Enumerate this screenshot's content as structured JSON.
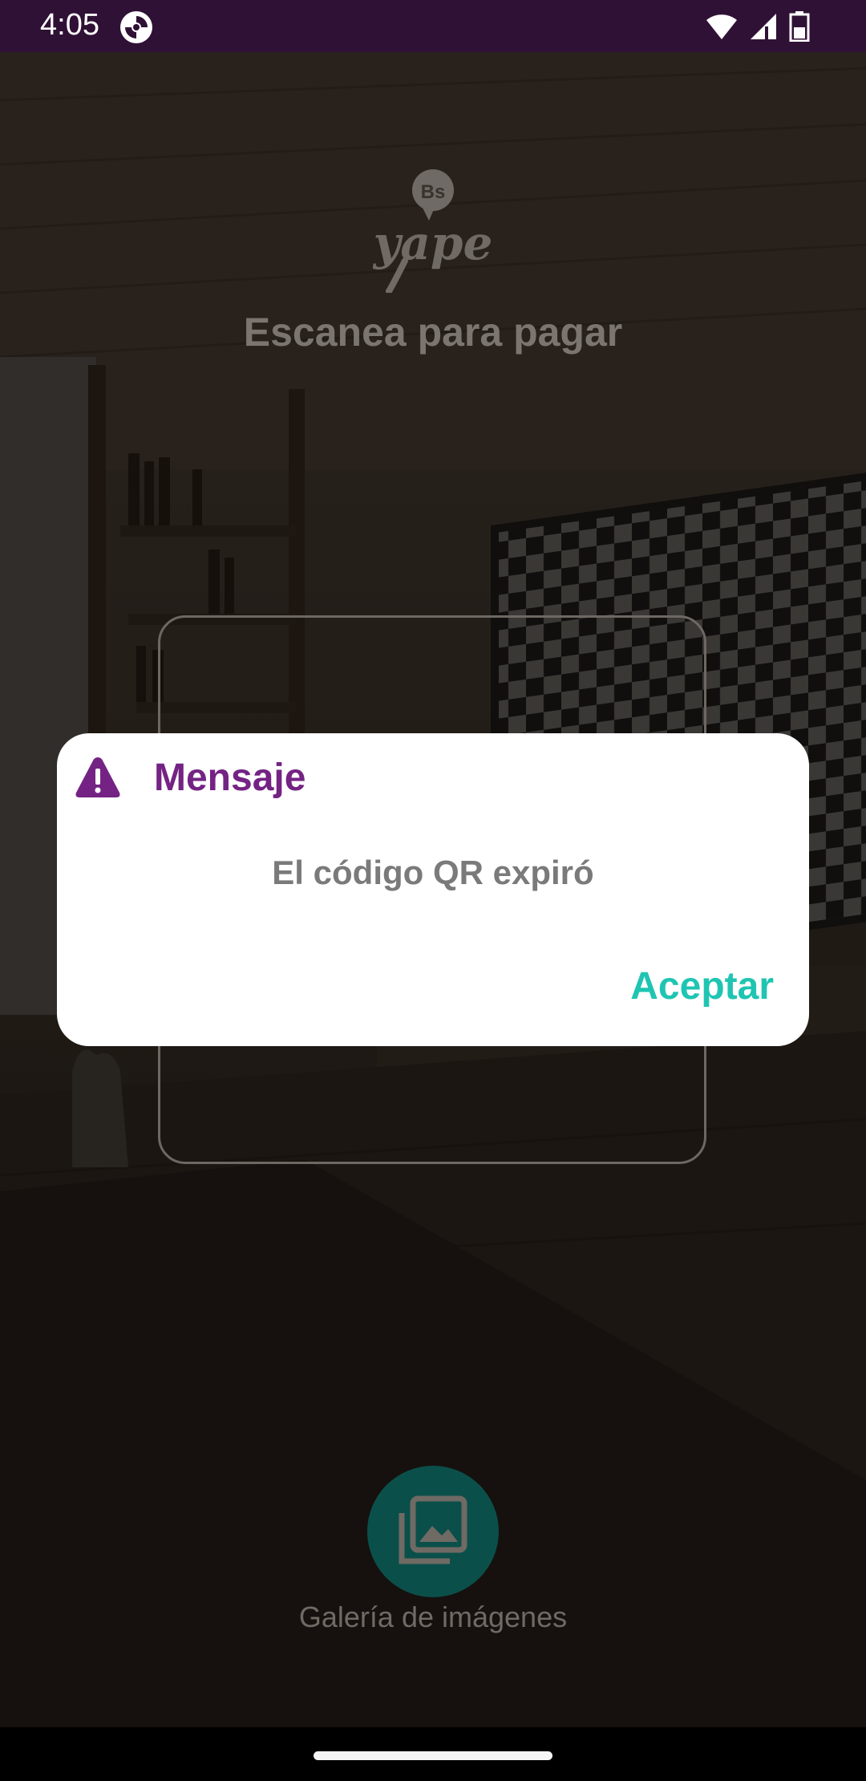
{
  "status_bar": {
    "time": "4:05",
    "icons": [
      "app-notification-icon",
      "wifi-icon",
      "cellular-signal-icon",
      "battery-icon"
    ]
  },
  "brand": {
    "logo_badge": "Bs",
    "logo_text": "yape"
  },
  "page": {
    "title": "Escanea para pagar"
  },
  "gallery": {
    "label": "Galería de imágenes",
    "icon": "image-gallery-icon"
  },
  "dialog": {
    "icon": "warning-icon",
    "title": "Mensaje",
    "message": "El código QR expiró",
    "accept_label": "Aceptar"
  },
  "colors": {
    "status_bar": "#301136",
    "dialog_title": "#742384",
    "accept": "#1fc5b2",
    "gallery_button": "#0b4f4a"
  }
}
